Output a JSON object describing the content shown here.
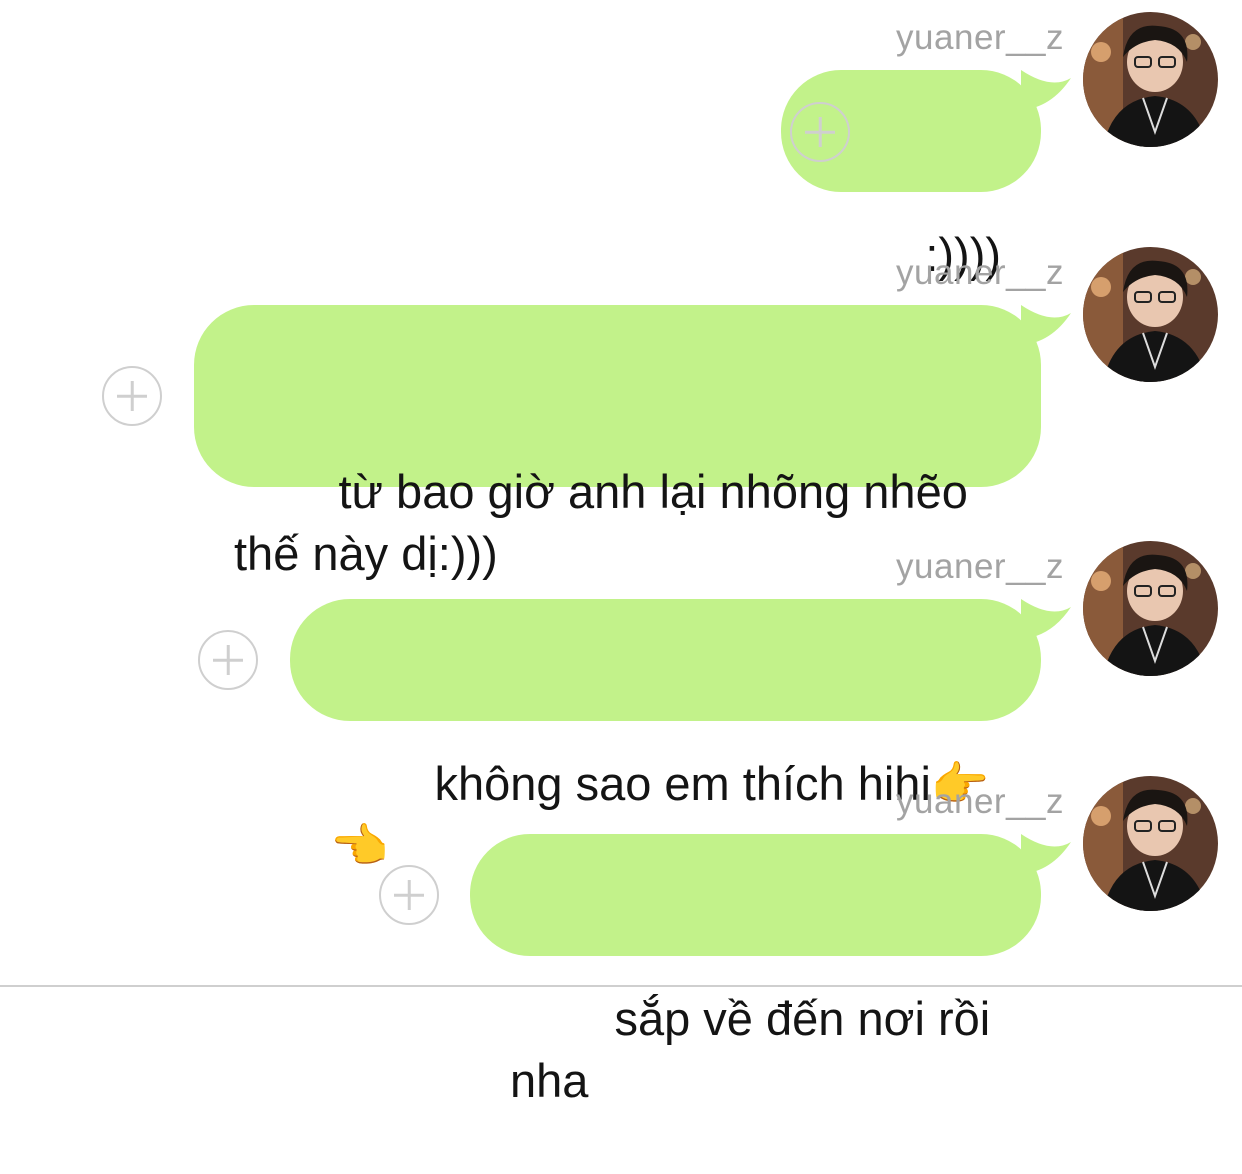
{
  "colors": {
    "bubble": "#c2f28a",
    "username": "#a3a3a3",
    "add_button": "#cfcfcf",
    "text": "#141414"
  },
  "messages": [
    {
      "username": "yuaner__z",
      "text": ":))))"
    },
    {
      "username": "yuaner__z",
      "text": "từ bao giờ anh lại nhõng nhẽo thế này dị:)))"
    },
    {
      "username": "yuaner__z",
      "text": "không sao em thích hihi👉👈"
    },
    {
      "username": "yuaner__z",
      "text": "sắp về đến nơi rồi nha"
    }
  ],
  "icons": {
    "add": "plus-circle-icon",
    "avatar": "avatar-photo"
  }
}
